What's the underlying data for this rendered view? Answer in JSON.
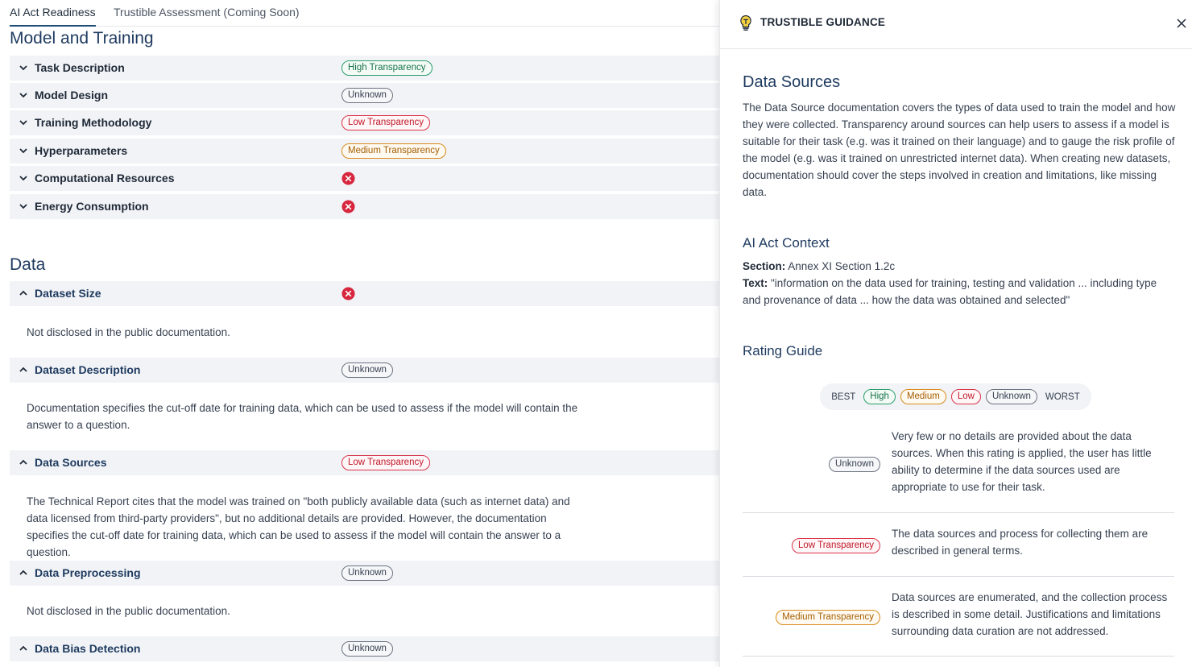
{
  "tabs": [
    {
      "label": "AI Act Readiness",
      "active": true
    },
    {
      "label": "Trustible Assessment (Coming Soon)",
      "active": false
    }
  ],
  "sections": {
    "model_training": {
      "title": "Model and Training",
      "rows": [
        {
          "label": "Task Description",
          "status": "High Transparency"
        },
        {
          "label": "Model Design",
          "status": "Unknown"
        },
        {
          "label": "Training Methodology",
          "status": "Low Transparency"
        },
        {
          "label": "Hyperparameters",
          "status": "Medium Transparency"
        },
        {
          "label": "Computational Resources",
          "status": "not-disclosed-icon"
        },
        {
          "label": "Energy Consumption",
          "status": "not-disclosed-icon"
        }
      ]
    },
    "data": {
      "title": "Data",
      "rows": [
        {
          "label": "Dataset Size",
          "status": "not-disclosed-icon",
          "detail": "Not disclosed in the public documentation."
        },
        {
          "label": "Dataset Description",
          "status": "Unknown",
          "detail": "Documentation specifies the cut-off date for training data, which can be used to assess if the model will contain the answer to a question."
        },
        {
          "label": "Data Sources",
          "status": "Low Transparency",
          "detail": "The Technical Report cites that the model was trained on \"both publicly available data (such as internet data) and data licensed from third-party providers\", but no additional details are provided. However, the documentation specifies the cut-off date for training data, which can be used to assess if the model will contain the answer to a question."
        },
        {
          "label": "Data Preprocessing",
          "status": "Unknown",
          "detail": "Not disclosed in the public documentation."
        },
        {
          "label": "Data Bias Detection",
          "status": "Unknown"
        }
      ]
    }
  },
  "panel": {
    "title": "TRUSTIBLE GUIDANCE",
    "heading": "Data Sources",
    "description": "The Data Source documentation covers the types of data used to train the model and how they were collected. Transparency around sources can help users to assess if a model is suitable for their task (e.g. was it trained on their language) and to gauge the risk profile of the model (e.g. was it trained on unrestricted internet data). When creating new datasets, documentation should cover the steps involved in creation and limitations, like missing data.",
    "context_heading": "AI Act Context",
    "section_label": "Section:",
    "section_value": " Annex XI Section 1.2c",
    "text_label": "Text:",
    "text_value": " \"information on the data used for training, testing and validation ... including type and provenance of data ... how the data was obtained and selected\"",
    "rating_heading": "Rating Guide",
    "scale": {
      "best": "BEST",
      "worst": "WORST",
      "levels": [
        "High",
        "Medium",
        "Low",
        "Unknown"
      ]
    },
    "guide": [
      {
        "badge": "Unknown",
        "text": "Very few or no details are provided about the data sources. When this rating is applied, the user has little ability to determine if the data sources used are appropriate to use for their task."
      },
      {
        "badge": "Low Transparency",
        "text": "The data sources and process for collecting them are described in general terms."
      },
      {
        "badge": "Medium Transparency",
        "text": "Data sources are enumerated, and the collection process is described in some detail. Justifications and limitations surrounding data curation are not addressed."
      }
    ]
  },
  "colors": {
    "high": "#2a9d6b",
    "medium": "#d98a1b",
    "low": "#d9344a",
    "unknown": "#6b7280",
    "not_disclosed": "#d7263d",
    "accent": "#1e3a5f"
  }
}
